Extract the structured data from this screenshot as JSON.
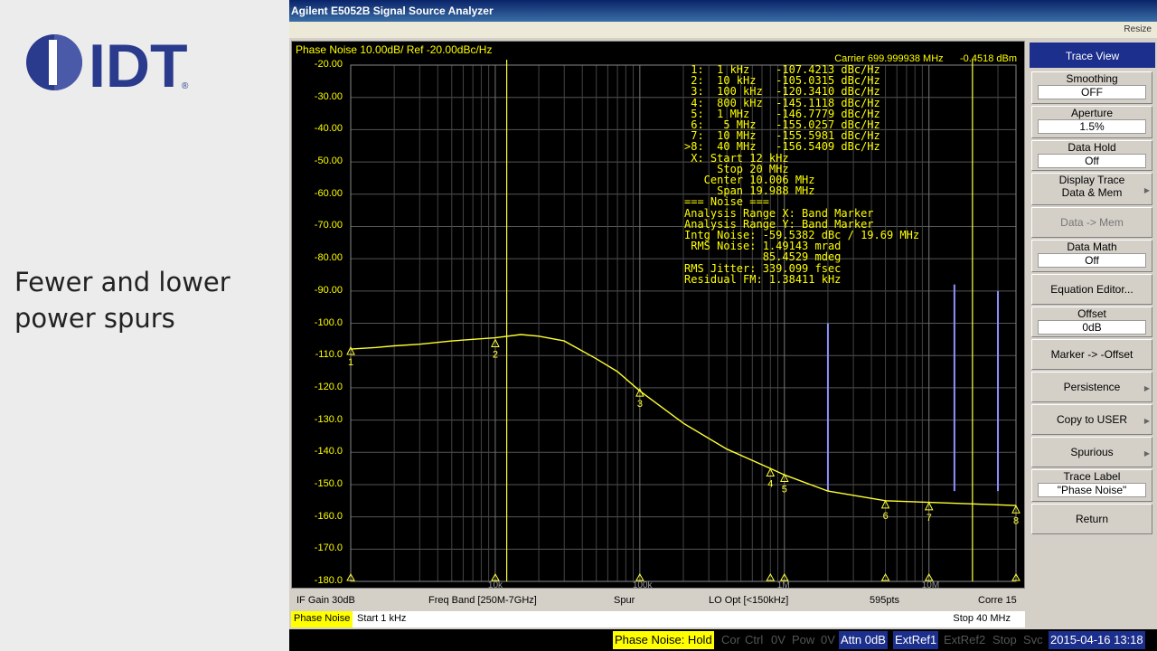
{
  "slide": {
    "logo_text": "IDT",
    "logo_reg": "®",
    "body_line1": "Fewer and lower",
    "body_line2": "power spurs"
  },
  "app": {
    "title": "Agilent E5052B Signal Source Analyzer",
    "menu_right": "Resize"
  },
  "screen": {
    "header_left": "Phase Noise 10.00dB/ Ref -20.00dBc/Hz",
    "carrier": "Carrier 699.999938 MHz",
    "carrier_level": "-0.4518 dBm",
    "y_ticks": [
      "-20.00",
      "-30.00",
      "-40.00",
      "-50.00",
      "-60.00",
      "-70.00",
      "-80.00",
      "-90.00",
      "-100.0",
      "-110.0",
      "-120.0",
      "-130.0",
      "-140.0",
      "-150.0",
      "-160.0",
      "-170.0",
      "-180.0"
    ],
    "marker_table": " 1:  1 kHz    -107.4213 dBc/Hz\n 2:  10 kHz   -105.0315 dBc/Hz\n 3:  100 kHz  -120.3410 dBc/Hz\n 4:  800 kHz  -145.1118 dBc/Hz\n 5:  1 MHz    -146.7779 dBc/Hz\n 6:   5 MHz   -155.0257 dBc/Hz\n 7:  10 MHz   -155.5981 dBc/Hz\n>8:  40 MHz   -156.5409 dBc/Hz\n X: Start 12 kHz\n     Stop 20 MHz\n   Center 10.006 MHz\n     Span 19.988 MHz\n=== Noise ===\nAnalysis Range X: Band Marker\nAnalysis Range Y: Band Marker\nIntg Noise: -59.5382 dBc / 19.69 MHz\n RMS Noise: 1.49143 mrad\n            85.4529 mdeg\nRMS Jitter: 339.099 fsec\nResidual FM: 1.38411 kHz"
  },
  "chart_data": {
    "type": "line",
    "x_scale": "log",
    "xlim": [
      1000,
      40000000
    ],
    "ylim": [
      -180,
      -20
    ],
    "x_tick_labels": [
      "10k",
      "100k",
      "1M",
      "10M"
    ],
    "series": [
      {
        "name": "Phase Noise",
        "color": "#ffff33",
        "x": [
          1000,
          1500,
          2000,
          3000,
          5000,
          7000,
          10000,
          15000,
          20000,
          30000,
          50000,
          70000,
          100000,
          200000,
          400000,
          800000,
          1000000,
          2000000,
          5000000,
          10000000,
          20000000,
          40000000
        ],
        "y": [
          -108,
          -107.5,
          -107,
          -106.5,
          -105.5,
          -105,
          -104.5,
          -103.5,
          -104,
          -105.5,
          -111,
          -115,
          -121,
          -131,
          -139,
          -145,
          -147,
          -152,
          -155,
          -155.5,
          -156,
          -156.5
        ]
      }
    ],
    "spurs": [
      {
        "x": 2000000,
        "y": -100
      },
      {
        "x": 15000000,
        "y": -88
      },
      {
        "x": 30000000,
        "y": -90
      }
    ],
    "markers": [
      {
        "id": "1",
        "x": 1000,
        "y": -107.4213
      },
      {
        "id": "2",
        "x": 10000,
        "y": -105.0315
      },
      {
        "id": "3",
        "x": 100000,
        "y": -120.341
      },
      {
        "id": "4",
        "x": 800000,
        "y": -145.1118
      },
      {
        "id": "5",
        "x": 1000000,
        "y": -146.7779
      },
      {
        "id": "6",
        "x": 5000000,
        "y": -155.0257
      },
      {
        "id": "7",
        "x": 10000000,
        "y": -155.5981
      },
      {
        "id": "8",
        "x": 40000000,
        "y": -156.5409
      }
    ],
    "band_lines_x": [
      12000,
      20000000
    ]
  },
  "status": {
    "if_gain": "IF Gain 30dB",
    "freq_band": "Freq Band [250M-7GHz]",
    "spur": "Spur",
    "lo_opt": "LO Opt [<150kHz]",
    "points": "595pts",
    "corre": "Corre 15",
    "trace": "Phase Noise",
    "start": "Start 1 kHz",
    "stop": "Stop 40 MHz"
  },
  "bottom": {
    "hold": "Phase Noise: Hold",
    "cor": "Cor",
    "ctrl": "Ctrl",
    "zero_v1": "0V",
    "pow": "Pow",
    "zero_v2": "0V",
    "attn": "Attn 0dB",
    "extref1": "ExtRef1",
    "extref2": "ExtRef2",
    "stop": "Stop",
    "svc": "Svc",
    "datetime": "2015-04-16 13:18"
  },
  "softkeys": {
    "title": "Trace View",
    "smoothing": "Smoothing",
    "smoothing_val": "OFF",
    "aperture": "Aperture",
    "aperture_val": "1.5%",
    "data_hold": "Data Hold",
    "data_hold_val": "Off",
    "display_trace": "Display Trace",
    "display_trace_val": "Data & Mem",
    "data_to_mem": "Data -> Mem",
    "data_math": "Data Math",
    "data_math_val": "Off",
    "equation_editor": "Equation Editor...",
    "offset": "Offset",
    "offset_val": "0dB",
    "marker_offset": "Marker -> -Offset",
    "persistence": "Persistence",
    "copy_to_user": "Copy to USER",
    "spurious": "Spurious",
    "trace_label": "Trace Label",
    "trace_label_val": "\"Phase Noise\"",
    "return": "Return"
  },
  "colors": {
    "trace": "#ffff33",
    "spur": "#9090ff",
    "grid": "#555555",
    "softkey_title": "#1c2f8c"
  }
}
